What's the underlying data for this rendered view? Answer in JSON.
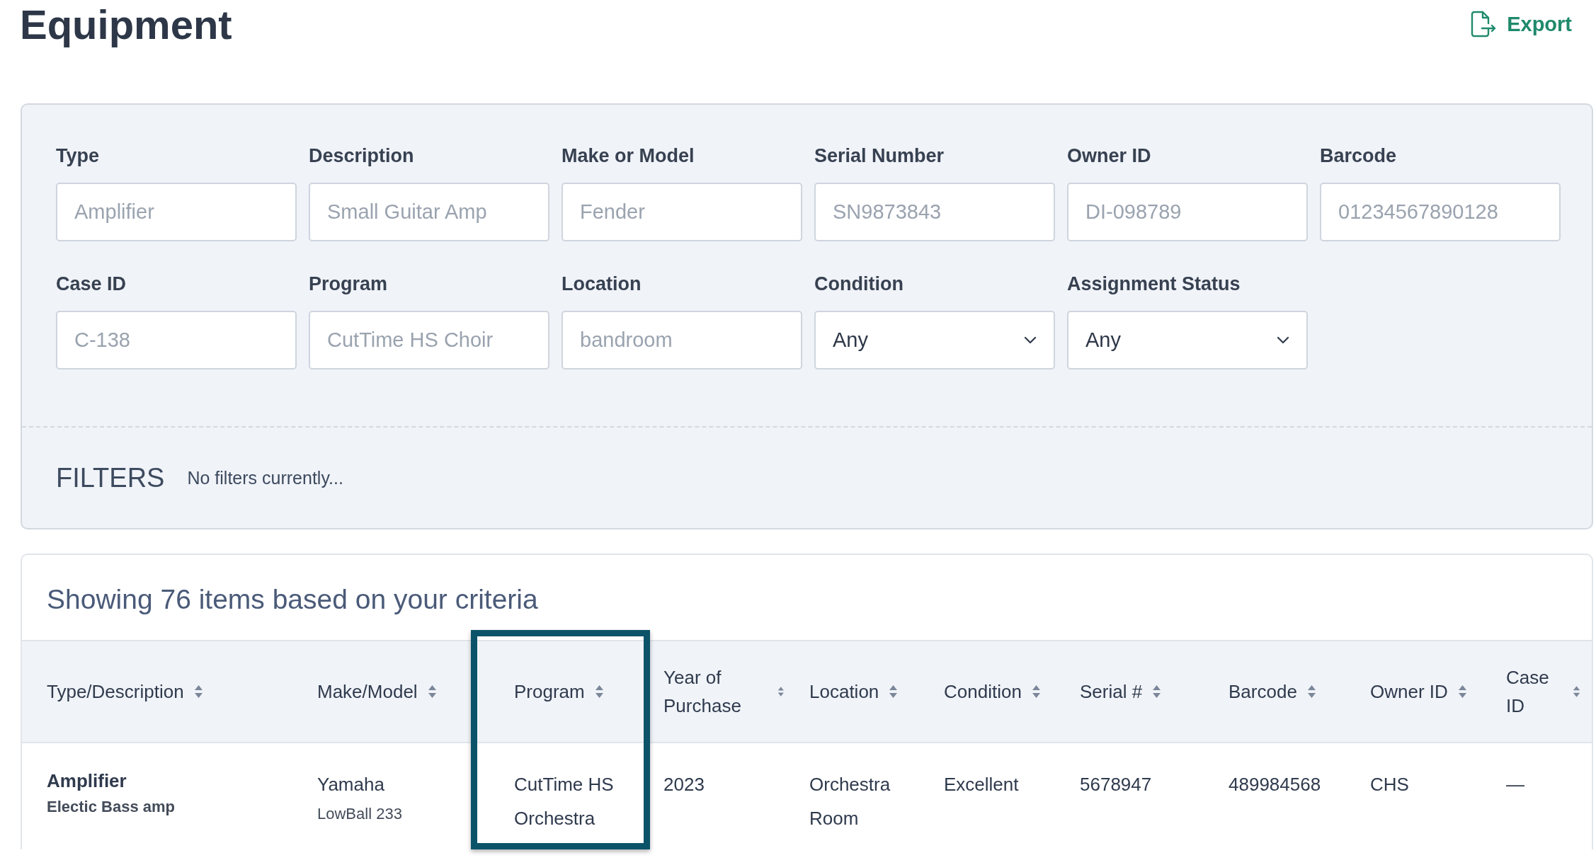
{
  "page": {
    "title": "Equipment",
    "export_label": "Export"
  },
  "filters_form": {
    "fields": [
      {
        "kind": "text",
        "label": "Type",
        "placeholder": "Amplifier"
      },
      {
        "kind": "text",
        "label": "Description",
        "placeholder": "Small Guitar Amp"
      },
      {
        "kind": "text",
        "label": "Make or Model",
        "placeholder": "Fender"
      },
      {
        "kind": "text",
        "label": "Serial Number",
        "placeholder": "SN9873843"
      },
      {
        "kind": "text",
        "label": "Owner ID",
        "placeholder": "DI-098789"
      },
      {
        "kind": "text",
        "label": "Barcode",
        "placeholder": "01234567890128"
      },
      {
        "kind": "text",
        "label": "Case ID",
        "placeholder": "C-138"
      },
      {
        "kind": "text",
        "label": "Program",
        "placeholder": "CutTime HS Choir"
      },
      {
        "kind": "text",
        "label": "Location",
        "placeholder": "bandroom"
      },
      {
        "kind": "select",
        "label": "Condition",
        "value": "Any"
      },
      {
        "kind": "select",
        "label": "Assignment Status",
        "value": "Any"
      }
    ],
    "filters_heading": "FILTERS",
    "filters_note": "No filters currently..."
  },
  "results": {
    "summary": "Showing 76 items based on your criteria",
    "table": {
      "columns": [
        {
          "label": "Type/Description",
          "highlighted": false
        },
        {
          "label": "Make/Model",
          "highlighted": false
        },
        {
          "label": "Program",
          "highlighted": true
        },
        {
          "label": "Year of Purchase",
          "highlighted": false
        },
        {
          "label": "Location",
          "highlighted": false
        },
        {
          "label": "Condition",
          "highlighted": false
        },
        {
          "label": "Serial #",
          "highlighted": false
        },
        {
          "label": "Barcode",
          "highlighted": false
        },
        {
          "label": "Owner ID",
          "highlighted": false
        },
        {
          "label": "Case ID",
          "highlighted": false
        }
      ],
      "rows": [
        {
          "cells": [
            {
              "main": "Amplifier",
              "sub": "Electic Bass amp",
              "bold": true
            },
            {
              "main": "Yamaha",
              "sub": "LowBall 233",
              "bold": false
            },
            {
              "main": "CutTime HS Orchestra"
            },
            {
              "main": "2023"
            },
            {
              "main": "Orchestra Room"
            },
            {
              "main": "Excellent"
            },
            {
              "main": "5678947"
            },
            {
              "main": "489984568"
            },
            {
              "main": "CHS"
            },
            {
              "main": "—"
            }
          ]
        }
      ]
    }
  }
}
